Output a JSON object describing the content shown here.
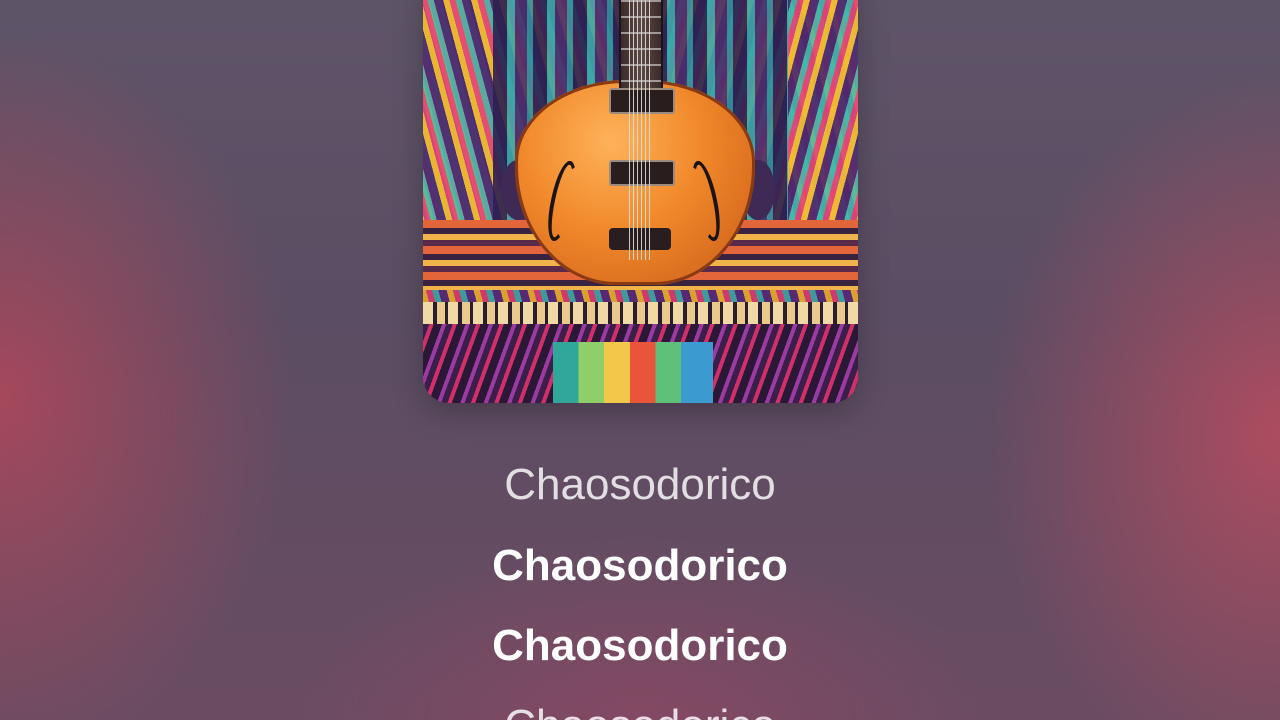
{
  "now_playing": {
    "artwork_icon": "guitar-album-art-icon",
    "lyrics": [
      {
        "text": "Chaosodorico",
        "state": "past"
      },
      {
        "text": "Chaosodorico",
        "state": "current"
      },
      {
        "text": "Chaosodorico",
        "state": "current"
      },
      {
        "text": "Chaosodorico",
        "state": "upcoming"
      }
    ]
  },
  "colors": {
    "background_top": "#5e5468",
    "background_edges": "#c8465a",
    "lyric_active": "#ffffff"
  }
}
